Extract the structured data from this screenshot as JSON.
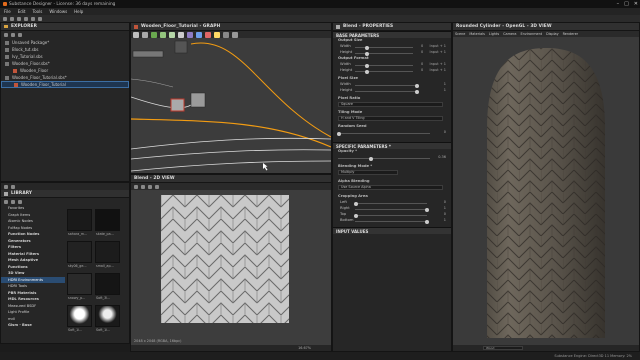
{
  "window": {
    "title": "Substance Designer - License: 36 days remaining",
    "controls": [
      "–",
      "□",
      "✕"
    ]
  },
  "menu": [
    "File",
    "Edit",
    "Tools",
    "Windows",
    "Help"
  ],
  "explorer": {
    "title": "EXPLORER",
    "items": [
      {
        "label": "Unsaved Package*",
        "depth": 1
      },
      {
        "label": "Block_tut.sbs",
        "depth": 1
      },
      {
        "label": "Ivy_Tutorial.sbs",
        "depth": 1
      },
      {
        "label": "Wooden_Floor.sbs*",
        "depth": 1
      },
      {
        "label": "Wooden_Floor",
        "depth": 2
      },
      {
        "label": "Wooden_Floor_Tutorial.sbs*",
        "depth": 1
      },
      {
        "label": "Wooden_Floor_Tutorial",
        "depth": 2
      }
    ]
  },
  "graph": {
    "title": "Wooden_Floor_Tutorial - GRAPH"
  },
  "library": {
    "title": "LIBRARY",
    "items": [
      {
        "label": "Favorites",
        "bold": false
      },
      {
        "label": "Graph Items",
        "bold": false
      },
      {
        "label": "Atomic Nodes",
        "bold": false
      },
      {
        "label": "FxMap Nodes",
        "bold": false
      },
      {
        "label": "Function Nodes",
        "bold": true
      },
      {
        "label": "Generators",
        "bold": true
      },
      {
        "label": "Filters",
        "bold": true
      },
      {
        "label": "Material Filters",
        "bold": true
      },
      {
        "label": "Mesh Adaptive",
        "bold": true
      },
      {
        "label": "Functions",
        "bold": true
      },
      {
        "label": "3D View",
        "bold": true
      },
      {
        "label": "HDRI Environments",
        "bold": false,
        "selected": true
      },
      {
        "label": "HDRI Tools",
        "bold": false
      },
      {
        "label": "PBR Materials",
        "bold": true
      },
      {
        "label": "MDL Resources",
        "bold": true
      },
      {
        "label": "Measured BSDF",
        "bold": false
      },
      {
        "label": "Light Profile",
        "bold": false
      },
      {
        "label": "mdl",
        "bold": false
      },
      {
        "label": "Glsm - Base",
        "bold": true
      }
    ],
    "thumbs": [
      "sahara_m...",
      "skate_pa...",
      "sky06_ge...",
      "small_ap...",
      "snowy_p...",
      "Soft_3l...",
      "Soft_1l...",
      "Soft_1l..."
    ]
  },
  "view2d": {
    "title": "Blend - 2D VIEW",
    "status": "2048 x 2048 (RGBA, 16bpc)",
    "zoom": "16.67%"
  },
  "properties": {
    "title": "Blend - PROPERTIES",
    "base_header": "BASE PARAMETERS",
    "output_size": {
      "label": "Output Size",
      "width_label": "Width",
      "height_label": "Height",
      "value": "0",
      "mode": "Input + 1"
    },
    "output_format": {
      "label": "Output Format",
      "width_label": "Width",
      "height_label": "Height",
      "value": "0",
      "mode": "Input + 1"
    },
    "pixel_size": {
      "label": "Pixel Size",
      "width_label": "Width",
      "height_label": "Height",
      "value": "1"
    },
    "pixel_ratio": {
      "label": "Pixel Ratio",
      "value": "Square"
    },
    "tiling_mode": {
      "label": "Tiling Mode",
      "value": "H and V Tiling"
    },
    "random_seed": {
      "label": "Random Seed",
      "value": "0"
    },
    "specific_header": "SPECIFIC PARAMETERS *",
    "opacity": {
      "label": "Opacity *",
      "value": "0.36",
      "fraction": 0.36
    },
    "blending_mode": {
      "label": "Blending Mode *",
      "value": "Multiply"
    },
    "alpha_blending": {
      "label": "Alpha Blending",
      "value": "Use Source Alpha"
    },
    "cropping": {
      "label": "Cropping Area",
      "left": "0",
      "right": "1",
      "top": "0",
      "bottom": "1",
      "left_label": "Left",
      "right_label": "Right",
      "top_label": "Top",
      "bottom_label": "Bottom"
    },
    "input_header": "INPUT VALUES"
  },
  "view3d": {
    "title": "Rounded Cylinder - OpenGL - 3D VIEW",
    "menu": [
      "Scene",
      "Materials",
      "Lights",
      "Camera",
      "Environment",
      "Display",
      "Renderer"
    ],
    "material": "Wood"
  },
  "statusbar": {
    "text": "Substance Engine: Direct3D 11   Memory: 2%"
  },
  "colors": {
    "accent": "#f39c12",
    "selection": "#2a4c72",
    "panel": "#262626"
  }
}
